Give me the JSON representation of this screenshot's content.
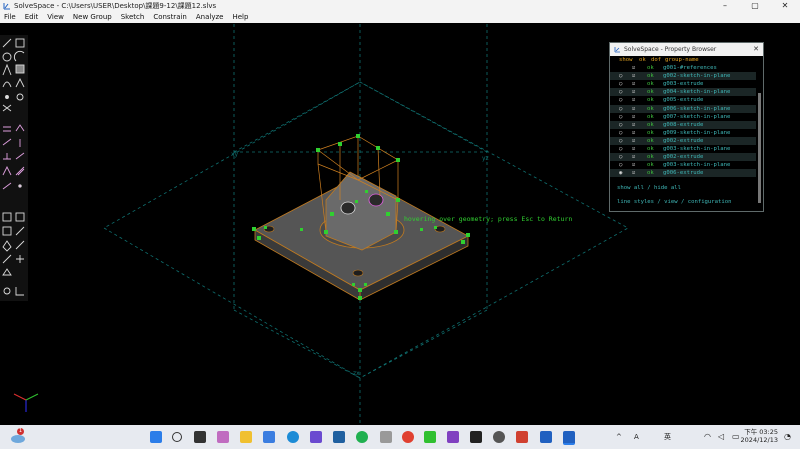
{
  "window": {
    "title": "SolveSpace - C:\\Users\\USER\\Desktop\\課題9-12\\課題12.slvs",
    "min": "–",
    "max": "▢",
    "close": "✕"
  },
  "menu": [
    "File",
    "Edit",
    "View",
    "New Group",
    "Sketch",
    "Constrain",
    "Analyze",
    "Help"
  ],
  "viewport": {
    "hint": "hovering over geometry; press Esc to Return",
    "axis_labels": {
      "xy": "xy",
      "yz": "yz",
      "zx": "zx"
    }
  },
  "browser": {
    "title": "SolveSpace - Property Browser",
    "close": "✕",
    "header": {
      "shown": "show",
      "active": "ok",
      "ok": "dof",
      "name": "group-name"
    },
    "groups": [
      {
        "shown": "",
        "active": "☑",
        "ok": "ok",
        "name": "g001-#references"
      },
      {
        "shown": "○",
        "active": "☑",
        "ok": "ok",
        "name": "g002-sketch-in-plane"
      },
      {
        "shown": "○",
        "active": "☑",
        "ok": "ok",
        "name": "g003-extrude"
      },
      {
        "shown": "○",
        "active": "☑",
        "ok": "ok",
        "name": "g004-sketch-in-plane"
      },
      {
        "shown": "○",
        "active": "☑",
        "ok": "ok",
        "name": "g005-extrude"
      },
      {
        "shown": "○",
        "active": "☑",
        "ok": "ok",
        "name": "g006-sketch-in-plane"
      },
      {
        "shown": "○",
        "active": "☑",
        "ok": "ok",
        "name": "g007-sketch-in-plane"
      },
      {
        "shown": "○",
        "active": "☑",
        "ok": "ok",
        "name": "g008-extrude"
      },
      {
        "shown": "○",
        "active": "☑",
        "ok": "ok",
        "name": "g009-sketch-in-plane"
      },
      {
        "shown": "○",
        "active": "☑",
        "ok": "ok",
        "name": "g002-extrude"
      },
      {
        "shown": "○",
        "active": "☑",
        "ok": "ok",
        "name": "g003-sketch-in-plane"
      },
      {
        "shown": "○",
        "active": "☑",
        "ok": "ok",
        "name": "g002-extrude"
      },
      {
        "shown": "○",
        "active": "☑",
        "ok": "ok",
        "name": "g003-sketch-in-plane"
      },
      {
        "shown": "◉",
        "active": "☑",
        "ok": "ok",
        "name": "g006-extrude"
      }
    ],
    "show_hide": "show all / hide all",
    "footer": "line styles / view / configuration"
  },
  "taskbar": {
    "notification_badge": "1",
    "tray": {
      "up": "^",
      "ime1": "A",
      "ime2": "英"
    },
    "time": "下午 03:25",
    "date": "2024/12/13"
  }
}
